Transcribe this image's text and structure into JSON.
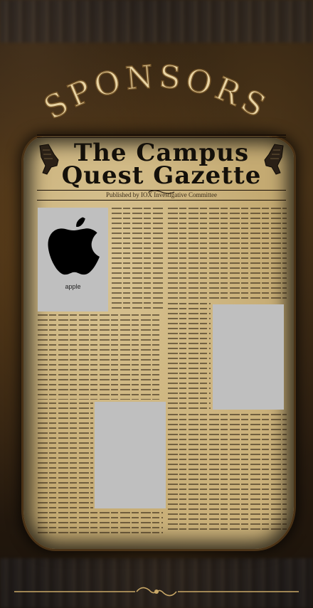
{
  "page": {
    "heading": "SPONSORS"
  },
  "newspaper": {
    "title_line1": "The Campus",
    "title_line2": "Quest Gazette",
    "published_by": "Published by IOX Investigative Committee"
  },
  "sponsors": [
    {
      "name": "apple",
      "icon": "apple-logo-icon"
    },
    {
      "name": "",
      "icon": ""
    },
    {
      "name": "",
      "icon": ""
    }
  ],
  "colors": {
    "heading_fill": "#e8d3a3",
    "heading_stroke": "#7a5a2c",
    "paper": "#c4aa72",
    "ink": "#14100a",
    "placeholder": "#bfbfbf"
  }
}
